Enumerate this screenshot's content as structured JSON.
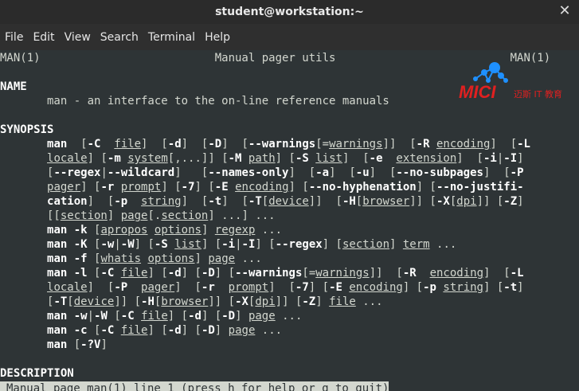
{
  "window": {
    "title": "student@workstation:~"
  },
  "menu": [
    "File",
    "Edit",
    "View",
    "Search",
    "Terminal",
    "Help"
  ],
  "logo": {
    "brand": "MICI",
    "subtitle": "迈斯 IT 教育"
  },
  "manpage": {
    "lines": [
      [
        {
          "t": "MAN(1)                          Manual pager utils                          MAN(1)"
        }
      ],
      [],
      [
        {
          "t": "NAME",
          "s": "b"
        }
      ],
      [
        {
          "t": "       man - an interface to the on-line reference manuals"
        }
      ],
      [],
      [
        {
          "t": "SYNOPSIS",
          "s": "b"
        }
      ],
      [
        {
          "t": "       "
        },
        {
          "t": "man",
          "s": "b"
        },
        {
          "t": "  ["
        },
        {
          "t": "-C",
          "s": "b"
        },
        {
          "t": "  "
        },
        {
          "t": "file",
          "s": "u"
        },
        {
          "t": "]  ["
        },
        {
          "t": "-d",
          "s": "b"
        },
        {
          "t": "]  ["
        },
        {
          "t": "-D",
          "s": "b"
        },
        {
          "t": "]  ["
        },
        {
          "t": "--warnings",
          "s": "b"
        },
        {
          "t": "[="
        },
        {
          "t": "warnings",
          "s": "u"
        },
        {
          "t": "]]  ["
        },
        {
          "t": "-R",
          "s": "b"
        },
        {
          "t": " "
        },
        {
          "t": "encoding",
          "s": "u"
        },
        {
          "t": "]  ["
        },
        {
          "t": "-L",
          "s": "b"
        }
      ],
      [
        {
          "t": "       "
        },
        {
          "t": "locale",
          "s": "u"
        },
        {
          "t": "] ["
        },
        {
          "t": "-m",
          "s": "b"
        },
        {
          "t": " "
        },
        {
          "t": "system",
          "s": "u"
        },
        {
          "t": "[,...]] ["
        },
        {
          "t": "-M",
          "s": "b"
        },
        {
          "t": " "
        },
        {
          "t": "path",
          "s": "u"
        },
        {
          "t": "] ["
        },
        {
          "t": "-S",
          "s": "b"
        },
        {
          "t": " "
        },
        {
          "t": "list",
          "s": "u"
        },
        {
          "t": "]  ["
        },
        {
          "t": "-e",
          "s": "b"
        },
        {
          "t": "  "
        },
        {
          "t": "extension",
          "s": "u"
        },
        {
          "t": "]  ["
        },
        {
          "t": "-i",
          "s": "b"
        },
        {
          "t": "|"
        },
        {
          "t": "-I",
          "s": "b"
        },
        {
          "t": "]"
        }
      ],
      [
        {
          "t": "       ["
        },
        {
          "t": "--regex",
          "s": "b"
        },
        {
          "t": "|"
        },
        {
          "t": "--wildcard",
          "s": "b"
        },
        {
          "t": "]   ["
        },
        {
          "t": "--names-only",
          "s": "b"
        },
        {
          "t": "]  ["
        },
        {
          "t": "-a",
          "s": "b"
        },
        {
          "t": "]  ["
        },
        {
          "t": "-u",
          "s": "b"
        },
        {
          "t": "]  ["
        },
        {
          "t": "--no-subpages",
          "s": "b"
        },
        {
          "t": "]  ["
        },
        {
          "t": "-P",
          "s": "b"
        }
      ],
      [
        {
          "t": "       "
        },
        {
          "t": "pager",
          "s": "u"
        },
        {
          "t": "] ["
        },
        {
          "t": "-r",
          "s": "b"
        },
        {
          "t": " "
        },
        {
          "t": "prompt",
          "s": "u"
        },
        {
          "t": "] ["
        },
        {
          "t": "-7",
          "s": "b"
        },
        {
          "t": "] ["
        },
        {
          "t": "-E",
          "s": "b"
        },
        {
          "t": " "
        },
        {
          "t": "encoding",
          "s": "u"
        },
        {
          "t": "] ["
        },
        {
          "t": "--no-hyphenation",
          "s": "b"
        },
        {
          "t": "] ["
        },
        {
          "t": "--no-justifi-",
          "s": "b"
        }
      ],
      [
        {
          "t": "       "
        },
        {
          "t": "cation",
          "s": "b"
        },
        {
          "t": "]  ["
        },
        {
          "t": "-p",
          "s": "b"
        },
        {
          "t": "  "
        },
        {
          "t": "string",
          "s": "u"
        },
        {
          "t": "]  ["
        },
        {
          "t": "-t",
          "s": "b"
        },
        {
          "t": "]  ["
        },
        {
          "t": "-T",
          "s": "b"
        },
        {
          "t": "["
        },
        {
          "t": "device",
          "s": "u"
        },
        {
          "t": "]]  ["
        },
        {
          "t": "-H",
          "s": "b"
        },
        {
          "t": "["
        },
        {
          "t": "browser",
          "s": "u"
        },
        {
          "t": "]] ["
        },
        {
          "t": "-X",
          "s": "b"
        },
        {
          "t": "["
        },
        {
          "t": "dpi",
          "s": "u"
        },
        {
          "t": "]] ["
        },
        {
          "t": "-Z",
          "s": "b"
        },
        {
          "t": "]"
        }
      ],
      [
        {
          "t": "       [["
        },
        {
          "t": "section",
          "s": "u"
        },
        {
          "t": "] "
        },
        {
          "t": "page",
          "s": "u"
        },
        {
          "t": "[."
        },
        {
          "t": "section",
          "s": "u"
        },
        {
          "t": "] ...] ..."
        }
      ],
      [
        {
          "t": "       "
        },
        {
          "t": "man",
          "s": "b"
        },
        {
          "t": " "
        },
        {
          "t": "-k",
          "s": "b"
        },
        {
          "t": " ["
        },
        {
          "t": "apropos",
          "s": "u"
        },
        {
          "t": " "
        },
        {
          "t": "options",
          "s": "u"
        },
        {
          "t": "] "
        },
        {
          "t": "regexp",
          "s": "u"
        },
        {
          "t": " ..."
        }
      ],
      [
        {
          "t": "       "
        },
        {
          "t": "man",
          "s": "b"
        },
        {
          "t": " "
        },
        {
          "t": "-K",
          "s": "b"
        },
        {
          "t": " ["
        },
        {
          "t": "-w",
          "s": "b"
        },
        {
          "t": "|"
        },
        {
          "t": "-W",
          "s": "b"
        },
        {
          "t": "] ["
        },
        {
          "t": "-S",
          "s": "b"
        },
        {
          "t": " "
        },
        {
          "t": "list",
          "s": "u"
        },
        {
          "t": "] ["
        },
        {
          "t": "-i",
          "s": "b"
        },
        {
          "t": "|"
        },
        {
          "t": "-I",
          "s": "b"
        },
        {
          "t": "] ["
        },
        {
          "t": "--regex",
          "s": "b"
        },
        {
          "t": "] ["
        },
        {
          "t": "section",
          "s": "u"
        },
        {
          "t": "] "
        },
        {
          "t": "term",
          "s": "u"
        },
        {
          "t": " ..."
        }
      ],
      [
        {
          "t": "       "
        },
        {
          "t": "man",
          "s": "b"
        },
        {
          "t": " "
        },
        {
          "t": "-f",
          "s": "b"
        },
        {
          "t": " ["
        },
        {
          "t": "whatis",
          "s": "u"
        },
        {
          "t": " "
        },
        {
          "t": "options",
          "s": "u"
        },
        {
          "t": "] "
        },
        {
          "t": "page",
          "s": "u"
        },
        {
          "t": " ..."
        }
      ],
      [
        {
          "t": "       "
        },
        {
          "t": "man",
          "s": "b"
        },
        {
          "t": " "
        },
        {
          "t": "-l",
          "s": "b"
        },
        {
          "t": " ["
        },
        {
          "t": "-C",
          "s": "b"
        },
        {
          "t": " "
        },
        {
          "t": "file",
          "s": "u"
        },
        {
          "t": "] ["
        },
        {
          "t": "-d",
          "s": "b"
        },
        {
          "t": "] ["
        },
        {
          "t": "-D",
          "s": "b"
        },
        {
          "t": "] ["
        },
        {
          "t": "--warnings",
          "s": "b"
        },
        {
          "t": "[="
        },
        {
          "t": "warnings",
          "s": "u"
        },
        {
          "t": "]]  ["
        },
        {
          "t": "-R",
          "s": "b"
        },
        {
          "t": "  "
        },
        {
          "t": "encoding",
          "s": "u"
        },
        {
          "t": "]  ["
        },
        {
          "t": "-L",
          "s": "b"
        }
      ],
      [
        {
          "t": "       "
        },
        {
          "t": "locale",
          "s": "u"
        },
        {
          "t": "]  ["
        },
        {
          "t": "-P",
          "s": "b"
        },
        {
          "t": "  "
        },
        {
          "t": "pager",
          "s": "u"
        },
        {
          "t": "]  ["
        },
        {
          "t": "-r",
          "s": "b"
        },
        {
          "t": "  "
        },
        {
          "t": "prompt",
          "s": "u"
        },
        {
          "t": "]  ["
        },
        {
          "t": "-7",
          "s": "b"
        },
        {
          "t": "] ["
        },
        {
          "t": "-E",
          "s": "b"
        },
        {
          "t": " "
        },
        {
          "t": "encoding",
          "s": "u"
        },
        {
          "t": "] ["
        },
        {
          "t": "-p",
          "s": "b"
        },
        {
          "t": " "
        },
        {
          "t": "string",
          "s": "u"
        },
        {
          "t": "] ["
        },
        {
          "t": "-t",
          "s": "b"
        },
        {
          "t": "]"
        }
      ],
      [
        {
          "t": "       ["
        },
        {
          "t": "-T",
          "s": "b"
        },
        {
          "t": "["
        },
        {
          "t": "device",
          "s": "u"
        },
        {
          "t": "]] ["
        },
        {
          "t": "-H",
          "s": "b"
        },
        {
          "t": "["
        },
        {
          "t": "browser",
          "s": "u"
        },
        {
          "t": "]] ["
        },
        {
          "t": "-X",
          "s": "b"
        },
        {
          "t": "["
        },
        {
          "t": "dpi",
          "s": "u"
        },
        {
          "t": "]] ["
        },
        {
          "t": "-Z",
          "s": "b"
        },
        {
          "t": "] "
        },
        {
          "t": "file",
          "s": "u"
        },
        {
          "t": " ..."
        }
      ],
      [
        {
          "t": "       "
        },
        {
          "t": "man",
          "s": "b"
        },
        {
          "t": " "
        },
        {
          "t": "-w",
          "s": "b"
        },
        {
          "t": "|"
        },
        {
          "t": "-W",
          "s": "b"
        },
        {
          "t": " ["
        },
        {
          "t": "-C",
          "s": "b"
        },
        {
          "t": " "
        },
        {
          "t": "file",
          "s": "u"
        },
        {
          "t": "] ["
        },
        {
          "t": "-d",
          "s": "b"
        },
        {
          "t": "] ["
        },
        {
          "t": "-D",
          "s": "b"
        },
        {
          "t": "] "
        },
        {
          "t": "page",
          "s": "u"
        },
        {
          "t": " ..."
        }
      ],
      [
        {
          "t": "       "
        },
        {
          "t": "man",
          "s": "b"
        },
        {
          "t": " "
        },
        {
          "t": "-c",
          "s": "b"
        },
        {
          "t": " ["
        },
        {
          "t": "-C",
          "s": "b"
        },
        {
          "t": " "
        },
        {
          "t": "file",
          "s": "u"
        },
        {
          "t": "] ["
        },
        {
          "t": "-d",
          "s": "b"
        },
        {
          "t": "] ["
        },
        {
          "t": "-D",
          "s": "b"
        },
        {
          "t": "] "
        },
        {
          "t": "page",
          "s": "u"
        },
        {
          "t": " ..."
        }
      ],
      [
        {
          "t": "       "
        },
        {
          "t": "man",
          "s": "b"
        },
        {
          "t": " ["
        },
        {
          "t": "-?V",
          "s": "b"
        },
        {
          "t": "]"
        }
      ],
      [],
      [
        {
          "t": "DESCRIPTION",
          "s": "b"
        }
      ]
    ]
  },
  "status": {
    "text": "Manual page man(1) line 1 (press h for help or q to quit)"
  },
  "colors": {
    "terminal_bg": "#2e3436",
    "terminal_fg": "#d3d7cf",
    "logo_blue": "#1e90ff",
    "logo_red": "#e02020"
  }
}
